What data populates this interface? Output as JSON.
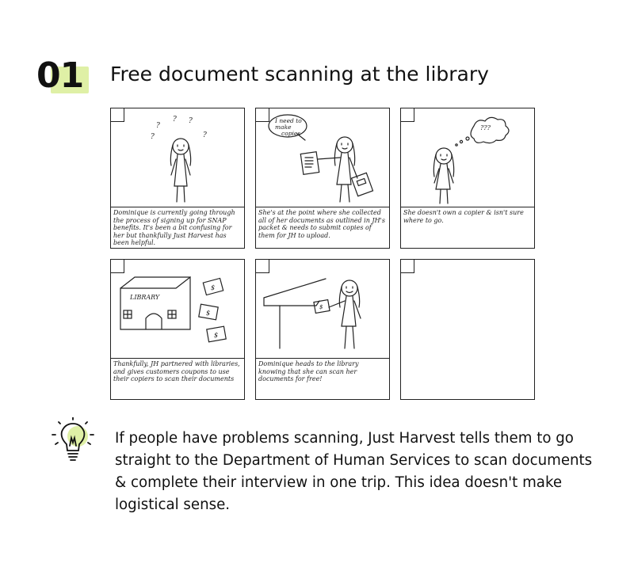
{
  "header": {
    "number": "01",
    "title": "Free document scanning at the library",
    "accent_color": "#dff0a6"
  },
  "storyboard": {
    "panels": [
      {
        "caption": "Dominique is currently going through the process of signing up for SNAP benefits. It's been a bit confusing for her but thankfully Just Harvest has been helpful.",
        "marks": [
          "?",
          "?",
          "?",
          "?",
          "?"
        ]
      },
      {
        "caption": "She's at the point where she collected all of her documents as outlined in JH's packet & needs to submit copies of them for JH to upload.",
        "bubble": "I need to make copies"
      },
      {
        "caption": "She doesn't own a copier & isn't sure where to go.",
        "bubble": "???"
      },
      {
        "caption": "Thankfully, JH partnered with libraries, and gives customers coupons to use their copiers to scan their documents",
        "sign": "LIBRARY",
        "coupon_symbol": "$"
      },
      {
        "caption": "Dominique heads to the library knowing that she can scan her documents for free!",
        "coupon_symbol": "$"
      },
      {
        "caption": ""
      }
    ]
  },
  "tip": {
    "icon": "lightbulb-icon",
    "text": "If people have problems scanning, Just Harvest tells them to go straight to the Department of Human Services to scan documents & complete their interview in one trip. This idea doesn't make logistical sense."
  }
}
